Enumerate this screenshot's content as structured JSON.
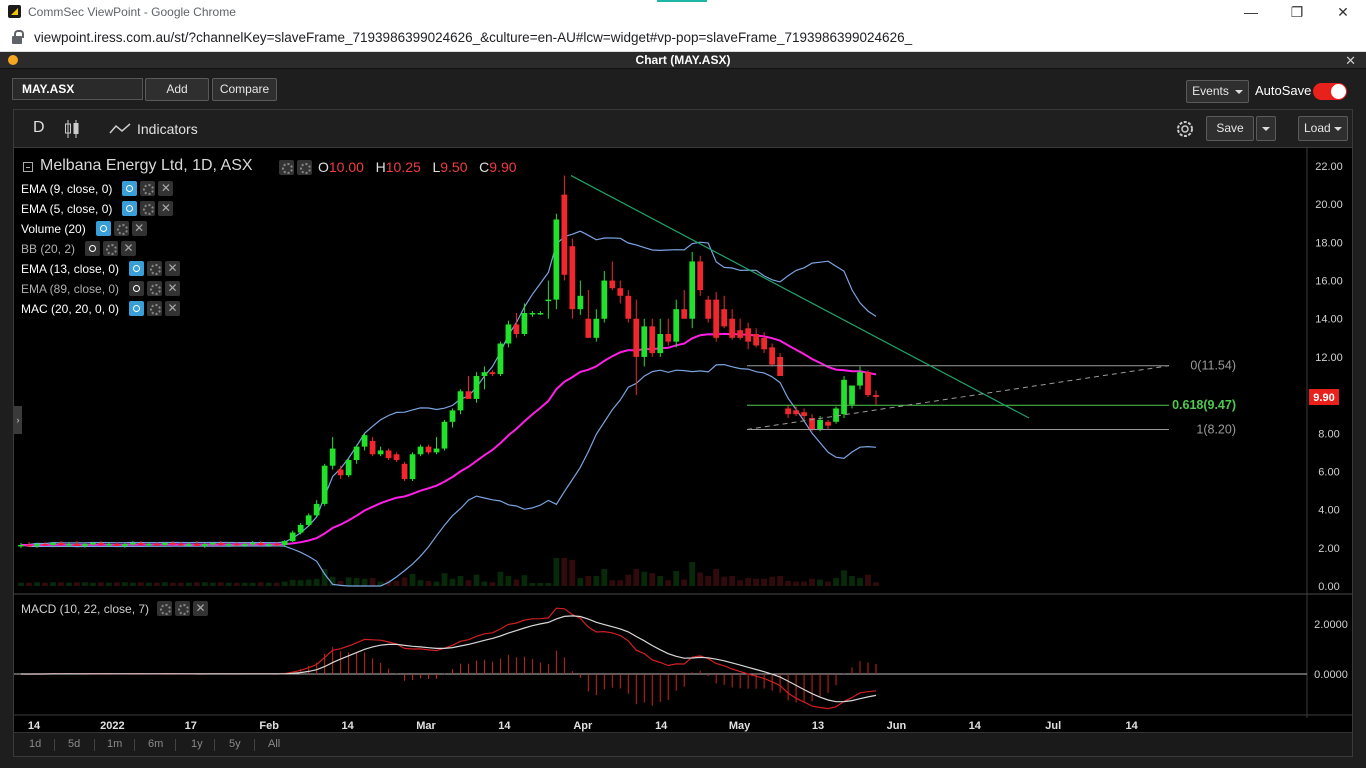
{
  "browser": {
    "tab_title": "CommSec ViewPoint - Google Chrome",
    "url": "viewpoint.iress.com.au/st/?channelKey=slaveFrame_7193986399024626_&culture=en-AU#lcw=widget#vp-pop=slaveFrame_7193986399024626_",
    "icons": [
      "lock-icon",
      "minimize-icon",
      "restore-icon",
      "close-icon"
    ]
  },
  "window": {
    "title": "Chart (MAY.ASX)",
    "close": "✕"
  },
  "topbar": {
    "symbol_value": "MAY.ASX",
    "add_label": "Add",
    "compare_label": "Compare",
    "events_label": "Events",
    "autosave_label": "AutoSave",
    "autosave_on": true
  },
  "toolbar": {
    "interval": "D",
    "indicators_label": "Indicators",
    "save_label": "Save",
    "load_label": "Load"
  },
  "legend": {
    "title": "Melbana Energy Ltd, 1D, ASX",
    "o_label": "O",
    "o_value": "10.00",
    "h_label": "H",
    "h_value": "10.25",
    "l_label": "L",
    "l_value": "9.50",
    "c_label": "C",
    "c_value": "9.90",
    "indicators": [
      {
        "label": "EMA (9, close, 0)",
        "visible": true
      },
      {
        "label": "EMA (5, close, 0)",
        "visible": true
      },
      {
        "label": "Volume (20)",
        "visible": true
      },
      {
        "label": "BB (20, 2)",
        "visible": false
      },
      {
        "label": "EMA (13, close, 0)",
        "visible": true
      },
      {
        "label": "EMA (89, close, 0)",
        "visible": false
      },
      {
        "label": "MAC (20, 20, 0, 0)",
        "visible": true
      }
    ],
    "macd_label": "MACD (10, 22, close, 7)"
  },
  "price_axis": {
    "ticks": [
      "22.00",
      "20.00",
      "18.00",
      "16.00",
      "14.00",
      "12.00",
      "9.90",
      "8.00",
      "6.00",
      "4.00",
      "2.00",
      "0.00"
    ],
    "last_price": "9.90",
    "last_price_color": "#e8211c"
  },
  "macd_axis": {
    "ticks": [
      "2.0000",
      "0.0000"
    ]
  },
  "time_axis": {
    "labels": [
      "14",
      "2022",
      "17",
      "Feb",
      "14",
      "Mar",
      "14",
      "Apr",
      "14",
      "May",
      "13",
      "Jun",
      "14",
      "Jul",
      "14"
    ]
  },
  "fibonacci": [
    {
      "label": "0(11.54)",
      "price": 11.54,
      "color": "#9a9a9a"
    },
    {
      "label": "0.618(9.47)",
      "price": 9.47,
      "color": "#4ecb4e"
    },
    {
      "label": "1(8.20)",
      "price": 8.2,
      "color": "#9a9a9a"
    }
  ],
  "range_buttons": [
    "1d",
    "5d",
    "1m",
    "6m",
    "1y",
    "5y",
    "All"
  ],
  "colors": {
    "up": "#22e12a",
    "down": "#f0282d",
    "bollinger": "#7aa4e0",
    "ema89": "#ff1ee6",
    "trendline": "#1fa36b",
    "macd_line": "#d8d8d8",
    "signal_line": "#d0201f"
  },
  "chart_data": {
    "type": "candlestick",
    "title": "Melbana Energy Ltd, 1D, ASX",
    "ylim": [
      0,
      22
    ],
    "candles": [
      {
        "o": 2.1,
        "h": 2.25,
        "l": 2.0,
        "c": 2.15
      },
      {
        "o": 2.15,
        "h": 2.3,
        "l": 2.05,
        "c": 2.1
      },
      {
        "o": 2.1,
        "h": 2.25,
        "l": 2.0,
        "c": 2.2
      },
      {
        "o": 2.2,
        "h": 2.3,
        "l": 2.1,
        "c": 2.15
      },
      {
        "o": 2.15,
        "h": 2.3,
        "l": 2.05,
        "c": 2.25
      },
      {
        "o": 2.25,
        "h": 2.35,
        "l": 2.1,
        "c": 2.15
      },
      {
        "o": 2.15,
        "h": 2.3,
        "l": 2.05,
        "c": 2.2
      },
      {
        "o": 2.2,
        "h": 2.35,
        "l": 2.1,
        "c": 2.1
      },
      {
        "o": 2.1,
        "h": 2.25,
        "l": 2.0,
        "c": 2.2
      },
      {
        "o": 2.2,
        "h": 2.3,
        "l": 2.1,
        "c": 2.25
      },
      {
        "o": 2.25,
        "h": 2.35,
        "l": 2.1,
        "c": 2.15
      },
      {
        "o": 2.15,
        "h": 2.3,
        "l": 2.05,
        "c": 2.2
      },
      {
        "o": 2.2,
        "h": 2.3,
        "l": 2.1,
        "c": 2.1
      },
      {
        "o": 2.1,
        "h": 2.25,
        "l": 2.0,
        "c": 2.2
      },
      {
        "o": 2.2,
        "h": 2.35,
        "l": 2.1,
        "c": 2.25
      },
      {
        "o": 2.25,
        "h": 2.35,
        "l": 2.1,
        "c": 2.15
      },
      {
        "o": 2.15,
        "h": 2.3,
        "l": 2.05,
        "c": 2.2
      },
      {
        "o": 2.2,
        "h": 2.3,
        "l": 2.1,
        "c": 2.15
      },
      {
        "o": 2.15,
        "h": 2.3,
        "l": 2.05,
        "c": 2.25
      },
      {
        "o": 2.25,
        "h": 2.35,
        "l": 2.1,
        "c": 2.2
      },
      {
        "o": 2.2,
        "h": 2.3,
        "l": 2.1,
        "c": 2.15
      },
      {
        "o": 2.15,
        "h": 2.3,
        "l": 2.05,
        "c": 2.2
      },
      {
        "o": 2.2,
        "h": 2.35,
        "l": 2.1,
        "c": 2.1
      },
      {
        "o": 2.1,
        "h": 2.25,
        "l": 2.0,
        "c": 2.2
      },
      {
        "o": 2.2,
        "h": 2.3,
        "l": 2.1,
        "c": 2.25
      },
      {
        "o": 2.25,
        "h": 2.35,
        "l": 2.1,
        "c": 2.15
      },
      {
        "o": 2.15,
        "h": 2.3,
        "l": 2.05,
        "c": 2.2
      },
      {
        "o": 2.2,
        "h": 2.3,
        "l": 2.1,
        "c": 2.15
      },
      {
        "o": 2.15,
        "h": 2.3,
        "l": 2.05,
        "c": 2.2
      },
      {
        "o": 2.2,
        "h": 2.35,
        "l": 2.1,
        "c": 2.25
      },
      {
        "o": 2.25,
        "h": 2.35,
        "l": 2.1,
        "c": 2.15
      },
      {
        "o": 2.15,
        "h": 2.3,
        "l": 2.05,
        "c": 2.2
      },
      {
        "o": 2.2,
        "h": 2.3,
        "l": 2.1,
        "c": 2.15
      },
      {
        "o": 2.15,
        "h": 2.4,
        "l": 2.05,
        "c": 2.35
      },
      {
        "o": 2.35,
        "h": 2.9,
        "l": 2.3,
        "c": 2.8
      },
      {
        "o": 2.8,
        "h": 3.3,
        "l": 2.7,
        "c": 3.2
      },
      {
        "o": 3.2,
        "h": 3.8,
        "l": 3.1,
        "c": 3.7
      },
      {
        "o": 3.7,
        "h": 4.5,
        "l": 3.6,
        "c": 4.3
      },
      {
        "o": 4.3,
        "h": 6.4,
        "l": 4.2,
        "c": 6.3
      },
      {
        "o": 6.3,
        "h": 7.8,
        "l": 6.1,
        "c": 7.2
      },
      {
        "o": 6.1,
        "h": 6.3,
        "l": 5.6,
        "c": 5.8
      },
      {
        "o": 5.8,
        "h": 6.7,
        "l": 5.7,
        "c": 6.6
      },
      {
        "o": 6.6,
        "h": 7.4,
        "l": 6.4,
        "c": 7.3
      },
      {
        "o": 7.3,
        "h": 8.0,
        "l": 7.1,
        "c": 7.9
      },
      {
        "o": 7.6,
        "h": 7.8,
        "l": 6.8,
        "c": 6.9
      },
      {
        "o": 6.9,
        "h": 7.3,
        "l": 6.8,
        "c": 7.1
      },
      {
        "o": 7.1,
        "h": 7.2,
        "l": 6.6,
        "c": 6.7
      },
      {
        "o": 6.9,
        "h": 7.0,
        "l": 6.5,
        "c": 6.6
      },
      {
        "o": 6.4,
        "h": 6.5,
        "l": 5.5,
        "c": 5.6
      },
      {
        "o": 5.6,
        "h": 7.0,
        "l": 5.5,
        "c": 6.9
      },
      {
        "o": 6.9,
        "h": 7.4,
        "l": 6.8,
        "c": 7.3
      },
      {
        "o": 7.3,
        "h": 7.4,
        "l": 6.9,
        "c": 7.0
      },
      {
        "o": 7.0,
        "h": 7.8,
        "l": 6.9,
        "c": 7.2
      },
      {
        "o": 7.2,
        "h": 8.7,
        "l": 7.1,
        "c": 8.6
      },
      {
        "o": 8.6,
        "h": 9.3,
        "l": 8.3,
        "c": 9.2
      },
      {
        "o": 9.2,
        "h": 10.3,
        "l": 9.0,
        "c": 10.2
      },
      {
        "o": 10.2,
        "h": 11.0,
        "l": 9.8,
        "c": 9.8
      },
      {
        "o": 9.8,
        "h": 11.2,
        "l": 9.6,
        "c": 11.0
      },
      {
        "o": 11.0,
        "h": 11.5,
        "l": 10.3,
        "c": 11.2
      },
      {
        "o": 11.2,
        "h": 11.3,
        "l": 11.0,
        "c": 11.1
      },
      {
        "o": 11.1,
        "h": 12.8,
        "l": 11.0,
        "c": 12.7
      },
      {
        "o": 12.7,
        "h": 13.9,
        "l": 12.5,
        "c": 13.7
      },
      {
        "o": 13.7,
        "h": 14.3,
        "l": 13.0,
        "c": 13.2
      },
      {
        "o": 13.2,
        "h": 14.8,
        "l": 13.1,
        "c": 14.3
      },
      {
        "o": 14.3,
        "h": 14.4,
        "l": 14.1,
        "c": 14.3
      },
      {
        "o": 14.3,
        "h": 14.4,
        "l": 14.2,
        "c": 14.3
      },
      {
        "o": 15.0,
        "h": 16.0,
        "l": 14.0,
        "c": 15.0
      },
      {
        "o": 15.0,
        "h": 19.5,
        "l": 14.5,
        "c": 19.2
      },
      {
        "o": 20.5,
        "h": 21.5,
        "l": 16.0,
        "c": 16.3
      },
      {
        "o": 17.8,
        "h": 18.2,
        "l": 14.0,
        "c": 14.5
      },
      {
        "o": 14.5,
        "h": 16.0,
        "l": 14.2,
        "c": 15.2
      },
      {
        "o": 14.0,
        "h": 15.5,
        "l": 13.0,
        "c": 13.0
      },
      {
        "o": 13.0,
        "h": 14.5,
        "l": 12.8,
        "c": 14.0
      },
      {
        "o": 14.0,
        "h": 16.5,
        "l": 13.8,
        "c": 16.0
      },
      {
        "o": 16.0,
        "h": 17.0,
        "l": 15.5,
        "c": 15.6
      },
      {
        "o": 15.6,
        "h": 16.0,
        "l": 14.8,
        "c": 15.2
      },
      {
        "o": 15.2,
        "h": 15.5,
        "l": 13.8,
        "c": 14.0
      },
      {
        "o": 14.0,
        "h": 15.0,
        "l": 10.0,
        "c": 12.0
      },
      {
        "o": 12.0,
        "h": 14.0,
        "l": 11.5,
        "c": 13.6
      },
      {
        "o": 13.6,
        "h": 14.0,
        "l": 12.0,
        "c": 12.2
      },
      {
        "o": 12.2,
        "h": 14.0,
        "l": 12.0,
        "c": 13.2
      },
      {
        "o": 13.2,
        "h": 14.0,
        "l": 12.6,
        "c": 12.8
      },
      {
        "o": 12.8,
        "h": 15.0,
        "l": 12.5,
        "c": 14.5
      },
      {
        "o": 14.5,
        "h": 15.5,
        "l": 14.0,
        "c": 14.0
      },
      {
        "o": 14.0,
        "h": 17.5,
        "l": 13.5,
        "c": 17.0
      },
      {
        "o": 17.0,
        "h": 17.3,
        "l": 15.2,
        "c": 15.5
      },
      {
        "o": 15.0,
        "h": 15.2,
        "l": 13.8,
        "c": 14.0
      },
      {
        "o": 15.0,
        "h": 15.4,
        "l": 12.8,
        "c": 13.0
      },
      {
        "o": 14.5,
        "h": 15.2,
        "l": 13.5,
        "c": 13.6
      },
      {
        "o": 14.0,
        "h": 14.5,
        "l": 12.9,
        "c": 13.0
      },
      {
        "o": 13.4,
        "h": 14.0,
        "l": 12.9,
        "c": 13.0
      },
      {
        "o": 13.5,
        "h": 13.8,
        "l": 12.4,
        "c": 12.8
      },
      {
        "o": 13.2,
        "h": 13.5,
        "l": 12.5,
        "c": 12.6
      },
      {
        "o": 13.0,
        "h": 13.3,
        "l": 12.2,
        "c": 12.4
      },
      {
        "o": 12.5,
        "h": 12.7,
        "l": 11.5,
        "c": 11.6
      },
      {
        "o": 12.0,
        "h": 12.2,
        "l": 11.0,
        "c": 11.0
      },
      {
        "o": 9.3,
        "h": 9.5,
        "l": 8.8,
        "c": 9.0
      },
      {
        "o": 9.2,
        "h": 9.4,
        "l": 8.9,
        "c": 9.0
      },
      {
        "o": 9.1,
        "h": 9.3,
        "l": 8.7,
        "c": 8.9
      },
      {
        "o": 8.8,
        "h": 9.0,
        "l": 8.1,
        "c": 8.2
      },
      {
        "o": 8.2,
        "h": 8.9,
        "l": 8.1,
        "c": 8.7
      },
      {
        "o": 8.6,
        "h": 8.7,
        "l": 8.2,
        "c": 8.4
      },
      {
        "o": 8.6,
        "h": 9.4,
        "l": 8.5,
        "c": 9.3
      },
      {
        "o": 9.0,
        "h": 11.0,
        "l": 8.8,
        "c": 10.8
      },
      {
        "o": 9.5,
        "h": 10.5,
        "l": 9.3,
        "c": 10.5
      },
      {
        "o": 10.5,
        "h": 11.5,
        "l": 10.3,
        "c": 11.2
      },
      {
        "o": 11.2,
        "h": 11.3,
        "l": 9.9,
        "c": 10.0
      },
      {
        "o": 10.0,
        "h": 10.25,
        "l": 9.5,
        "c": 9.9
      }
    ]
  }
}
